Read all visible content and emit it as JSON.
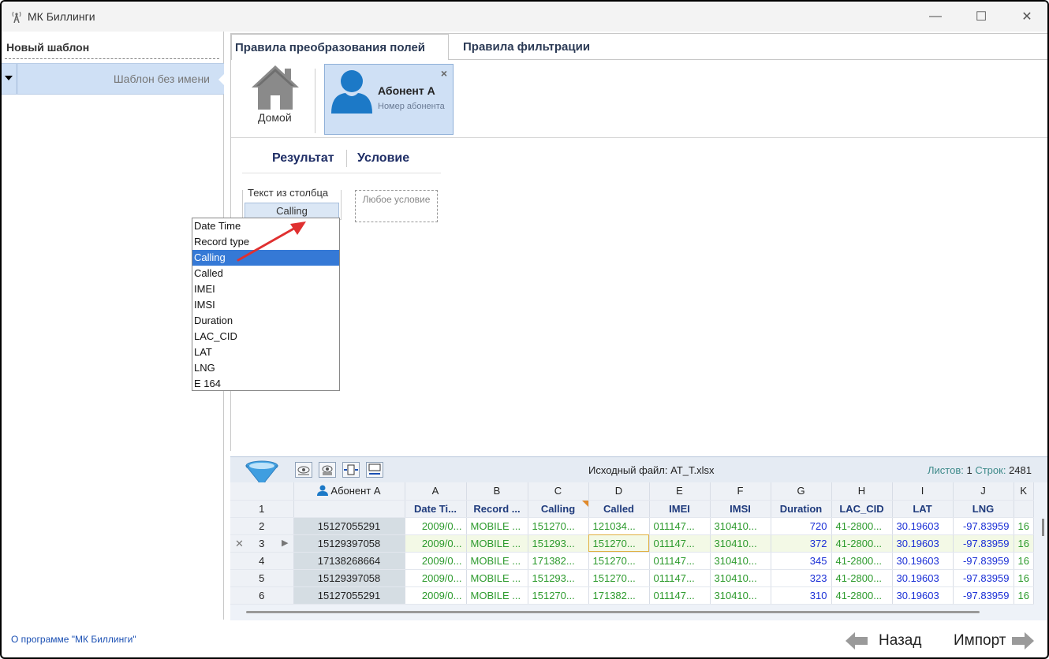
{
  "window": {
    "title": "МК Биллинги",
    "minimize_glyph": "—",
    "maximize_glyph": "☐",
    "close_glyph": "✕"
  },
  "left": {
    "header": "Новый шаблон",
    "template_name": "Шаблон без имени"
  },
  "tabs": {
    "active": "Правила преобразования полей",
    "inactive": "Правила фильтрации"
  },
  "cards": {
    "home_label": "Домой",
    "subscriber_name": "Абонент А",
    "subscriber_sub": "Номер абонента",
    "close_glyph": "×"
  },
  "rules": {
    "result_header": "Результат",
    "condition_header": "Условие",
    "text_from_column_caption": "Текст из столбца",
    "text_from_column_value": "Calling",
    "any_condition": "Любое условие"
  },
  "dropdown": {
    "items": [
      "Date Time",
      "Record type",
      "Calling",
      "Called",
      "IMEI",
      "IMSI",
      "Duration",
      "LAC_CID",
      "LAT",
      "LNG",
      "E 164"
    ],
    "selected": "Calling"
  },
  "grid": {
    "source_file": "Исходный файл: AT_T.xlsx",
    "sheets_label": "Листов:",
    "sheets_value": "1",
    "rows_label": "Строк:",
    "rows_value": "2481",
    "subscriber_col": "Абонент А",
    "col_letters": [
      "A",
      "B",
      "C",
      "D",
      "E",
      "F",
      "G",
      "H",
      "I",
      "J",
      "K"
    ],
    "col_names": [
      "Date Ti...",
      "Record ...",
      "Calling",
      "Called",
      "IMEI",
      "IMSI",
      "Duration",
      "LAC_CID",
      "LAT",
      "LNG",
      ""
    ],
    "header_row_num": "1",
    "current_row_marker": "✕",
    "current_row_pointer": "▶",
    "rows": [
      {
        "num": "2",
        "sub": "15127055291",
        "cells": [
          "2009/0...",
          "MOBILE ...",
          "151270...",
          "121034...",
          "011147...",
          "310410...",
          "720",
          "41-2800...",
          "30.19603",
          "-97.83959",
          "16"
        ]
      },
      {
        "num": "3",
        "sub": "15129397058",
        "cells": [
          "2009/0...",
          "MOBILE ...",
          "151293...",
          "151270...",
          "011147...",
          "310410...",
          "372",
          "41-2800...",
          "30.19603",
          "-97.83959",
          "16"
        ]
      },
      {
        "num": "4",
        "sub": "17138268664",
        "cells": [
          "2009/0...",
          "MOBILE ...",
          "171382...",
          "151270...",
          "011147...",
          "310410...",
          "345",
          "41-2800...",
          "30.19603",
          "-97.83959",
          "16"
        ]
      },
      {
        "num": "5",
        "sub": "15129397058",
        "cells": [
          "2009/0...",
          "MOBILE ...",
          "151293...",
          "151270...",
          "011147...",
          "310410...",
          "323",
          "41-2800...",
          "30.19603",
          "-97.83959",
          "16"
        ]
      },
      {
        "num": "6",
        "sub": "15127055291",
        "cells": [
          "2009/0...",
          "MOBILE ...",
          "151270...",
          "171382...",
          "011147...",
          "310410...",
          "310",
          "41-2800...",
          "30.19603",
          "-97.83959",
          "16"
        ]
      }
    ]
  },
  "footer": {
    "about": "О программе \"МК Биллинги\"",
    "back": "Назад",
    "import": "Импорт"
  }
}
